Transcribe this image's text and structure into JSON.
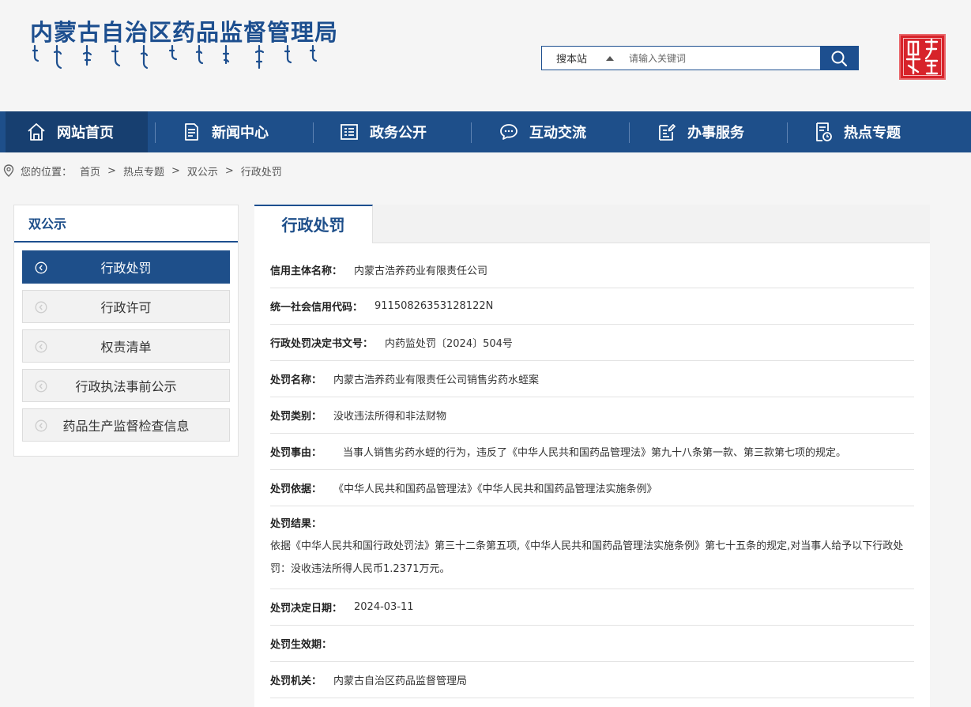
{
  "header": {
    "site_name": "内蒙古自治区药品监督管理局",
    "search": {
      "scope": "搜本站",
      "placeholder": "请输入关键词"
    }
  },
  "nav": {
    "items": [
      {
        "label": "网站首页",
        "icon": "home-icon",
        "active": true
      },
      {
        "label": "新闻中心",
        "icon": "document-icon"
      },
      {
        "label": "政务公开",
        "icon": "list-icon"
      },
      {
        "label": "互动交流",
        "icon": "chat-icon"
      },
      {
        "label": "办事服务",
        "icon": "edit-icon"
      },
      {
        "label": "热点专题",
        "icon": "clock-document-icon"
      }
    ]
  },
  "breadcrumb": {
    "prefix": "您的位置：",
    "items": [
      "首页",
      "热点专题",
      "双公示",
      "行政处罚"
    ],
    "separator": ">"
  },
  "sidebar": {
    "title": "双公示",
    "items": [
      {
        "label": "行政处罚",
        "active": true
      },
      {
        "label": "行政许可"
      },
      {
        "label": "权责清单"
      },
      {
        "label": "行政执法事前公示"
      },
      {
        "label": "药品生产监督检查信息"
      }
    ]
  },
  "main": {
    "tab": "行政处罚",
    "fields": [
      {
        "label": "信用主体名称：",
        "value": "内蒙古浩养药业有限责任公司"
      },
      {
        "label": "统一社会信用代码：",
        "value": "91150826353128122N"
      },
      {
        "label": "行政处罚决定书文号：",
        "value": "内药监处罚〔2024〕504号"
      },
      {
        "label": "处罚名称：",
        "value": "内蒙古浩养药业有限责任公司销售劣药水蛭案"
      },
      {
        "label": "处罚类别：",
        "value": "没收违法所得和非法财物"
      },
      {
        "label": "处罚事由：",
        "value": "当事人销售劣药水蛭的行为，违反了《中华人民共和国药品管理法》第九十八条第一款、第三款第七项的规定。"
      },
      {
        "label": "处罚依据：",
        "value": "《中华人民共和国药品管理法》《中华人民共和国药品管理法实施条例》"
      },
      {
        "label": "处罚结果：",
        "value": "依据《中华人民共和国行政处罚法》第三十二条第五项,《中华人民共和国药品管理法实施条例》第七十五条的规定,对当事人给予以下行政处罚：没收违法所得人民币1.2371万元。"
      },
      {
        "label": "处罚决定日期：",
        "value": "2024-03-11"
      },
      {
        "label": "处罚生效期：",
        "value": ""
      },
      {
        "label": "处罚机关：",
        "value": "内蒙古自治区药品监督管理局"
      }
    ]
  },
  "colors": {
    "brand_blue": "#1e4f8a",
    "nav_active": "#173f70",
    "seal_red": "#d7232a"
  }
}
